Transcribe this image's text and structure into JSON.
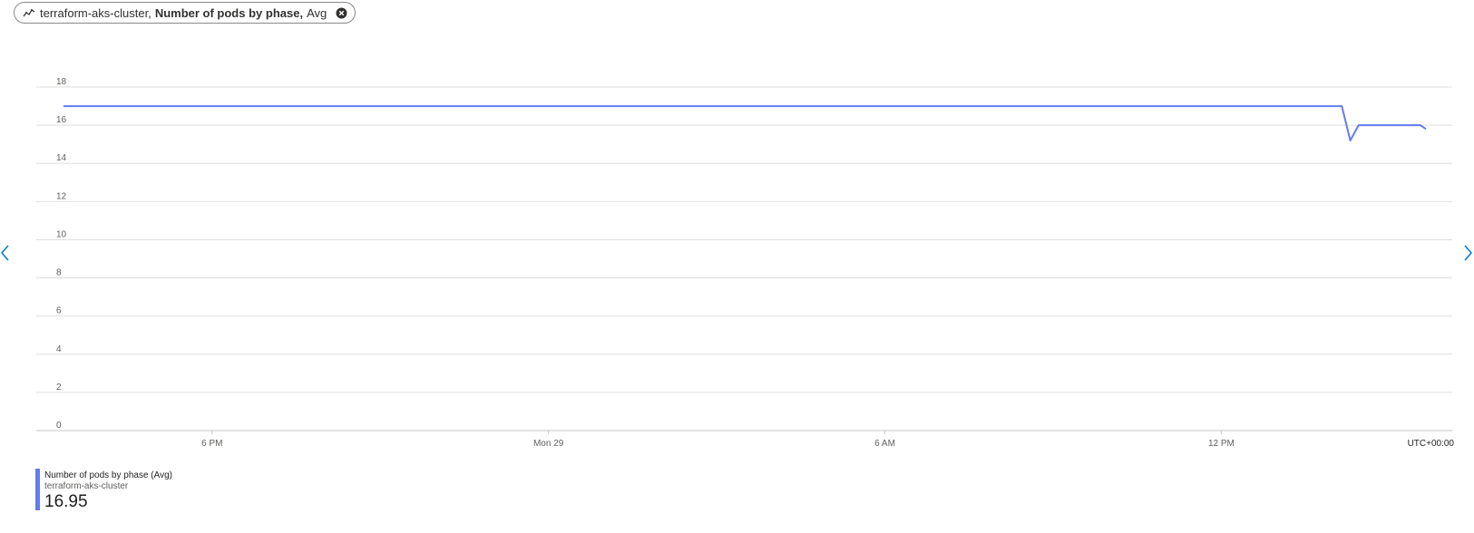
{
  "pill": {
    "resource": "terraform-aks-cluster,",
    "metric": "Number of pods by phase,",
    "aggregation": "Avg",
    "icon": "line-chart-icon",
    "close_icon": "close-circle-icon"
  },
  "nav": {
    "left_icon": "chevron-left-icon",
    "right_icon": "chevron-right-icon"
  },
  "chart_data": {
    "type": "line",
    "title": "",
    "xlabel": "",
    "ylabel": "",
    "ylim": [
      0,
      18
    ],
    "yticks": [
      0,
      2,
      4,
      6,
      8,
      10,
      12,
      14,
      16,
      18
    ],
    "x_tick_labels": [
      "6 PM",
      "Mon 29",
      "6 AM",
      "12 PM"
    ],
    "x_tick_hours": [
      0,
      12,
      24,
      36
    ],
    "x_range_hours": [
      -5.3,
      43.3
    ],
    "timezone_label": "UTC+00:00",
    "grid": true,
    "series": [
      {
        "name": "Number of pods by phase (Avg)",
        "color": "#637cef",
        "x_hours": [
          -5.3,
          40.3,
          40.6,
          40.9,
          43.1,
          43.3
        ],
        "values": [
          17,
          17,
          15.2,
          16,
          16,
          15.8
        ]
      }
    ]
  },
  "legend": {
    "name": "Number of pods by phase (Avg)",
    "resource": "terraform-aks-cluster",
    "value": "16.95",
    "color": "#637cef"
  }
}
